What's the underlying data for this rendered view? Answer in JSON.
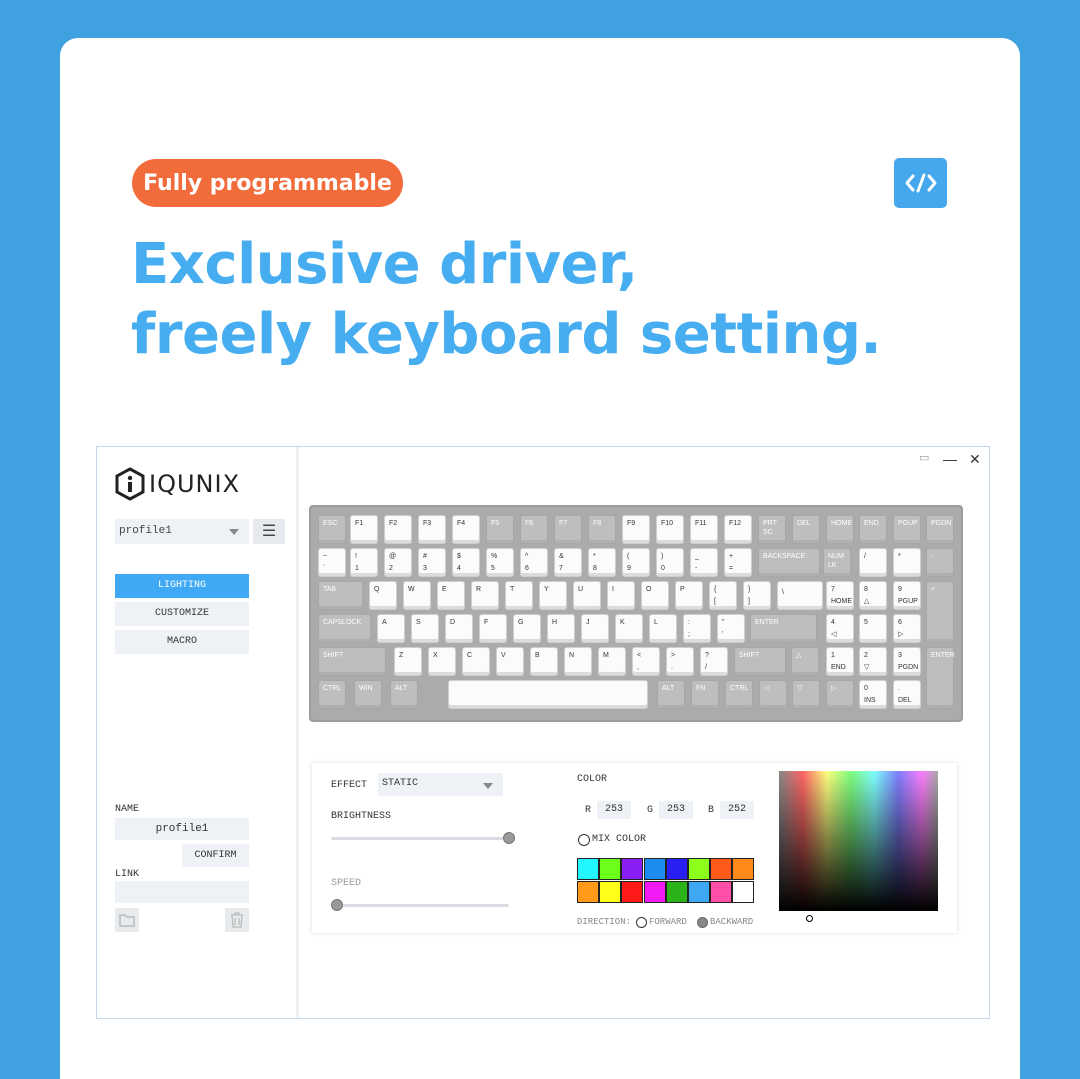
{
  "promo": {
    "badge": "Fully programmable",
    "code_icon": "code-icon",
    "headline_line1": "Exclusive driver,",
    "headline_line2": "freely keyboard setting."
  },
  "app": {
    "brand": "IQUNIX",
    "profile_select": "profile1",
    "menu_icon": "☰",
    "nav": [
      "LIGHTING",
      "CUSTOMIZE",
      "MACRO"
    ],
    "active_nav": "LIGHTING",
    "name_label": "NAME",
    "name_value": "profile1",
    "confirm_label": "CONFIRM",
    "link_label": "LINK",
    "link_value": "",
    "window_controls": [
      "▭",
      "—",
      "✕"
    ]
  },
  "keyboard": {
    "rows": [
      [
        [
          "ESC",
          "g"
        ],
        [
          "F1",
          "w"
        ],
        [
          "F2",
          "w"
        ],
        [
          "F3",
          "w"
        ],
        [
          "F4",
          "w"
        ],
        [
          "F5",
          "g"
        ],
        [
          "F6",
          "g"
        ],
        [
          "F7",
          "g"
        ],
        [
          "F8",
          "g"
        ],
        [
          "F9",
          "w"
        ],
        [
          "F10",
          "w"
        ],
        [
          "F11",
          "w"
        ],
        [
          "F12",
          "w"
        ],
        [
          "PRT SC",
          "g"
        ],
        [
          "DEL",
          "g"
        ],
        [
          "HOME",
          "g"
        ],
        [
          "END",
          "g"
        ],
        [
          "PGUP",
          "g"
        ],
        [
          "PGDN",
          "g"
        ]
      ],
      [
        [
          "~|`",
          "w"
        ],
        [
          "!|1",
          "w"
        ],
        [
          "@|2",
          "w"
        ],
        [
          "#|3",
          "w"
        ],
        [
          "$|4",
          "w"
        ],
        [
          "%|5",
          "w"
        ],
        [
          "^|6",
          "w"
        ],
        [
          "&|7",
          "w"
        ],
        [
          "*|8",
          "w"
        ],
        [
          "(|9",
          "w"
        ],
        [
          ")|0",
          "w"
        ],
        [
          "_|-",
          "w"
        ],
        [
          "+|=",
          "w"
        ],
        [
          "BACKSPACE",
          "g"
        ],
        [
          "NUM LK",
          "g"
        ],
        [
          "/",
          "w"
        ],
        [
          "*",
          "w"
        ],
        [
          "-",
          "g"
        ]
      ],
      [
        [
          "TAB",
          "g"
        ],
        [
          "Q",
          "w"
        ],
        [
          "W",
          "w"
        ],
        [
          "E",
          "w"
        ],
        [
          "R",
          "w"
        ],
        [
          "T",
          "w"
        ],
        [
          "Y",
          "w"
        ],
        [
          "U",
          "w"
        ],
        [
          "I",
          "w"
        ],
        [
          "O",
          "w"
        ],
        [
          "P",
          "w"
        ],
        [
          "{|[",
          "w"
        ],
        [
          "}|]",
          "w"
        ],
        [
          "||\\",
          "w"
        ],
        [
          "7|HOME",
          "w"
        ],
        [
          "8|△",
          "w"
        ],
        [
          "9|PGUP",
          "w"
        ],
        [
          "+",
          "g"
        ]
      ],
      [
        [
          "CAPSLOCK",
          "g"
        ],
        [
          "A",
          "w"
        ],
        [
          "S",
          "w"
        ],
        [
          "D",
          "w"
        ],
        [
          "F",
          "w"
        ],
        [
          "G",
          "w"
        ],
        [
          "H",
          "w"
        ],
        [
          "J",
          "w"
        ],
        [
          "K",
          "w"
        ],
        [
          "L",
          "w"
        ],
        [
          ":|;",
          "w"
        ],
        [
          "\"|'",
          "w"
        ],
        [
          "ENTER",
          "g"
        ],
        [
          "4|◁",
          "w"
        ],
        [
          "5",
          "w"
        ],
        [
          "6|▷",
          "w"
        ]
      ],
      [
        [
          "SHIFT",
          "g"
        ],
        [
          "Z",
          "w"
        ],
        [
          "X",
          "w"
        ],
        [
          "C",
          "w"
        ],
        [
          "V",
          "w"
        ],
        [
          "B",
          "w"
        ],
        [
          "N",
          "w"
        ],
        [
          "M",
          "w"
        ],
        [
          "<|,",
          "w"
        ],
        [
          ">|.",
          "w"
        ],
        [
          "?|/",
          "w"
        ],
        [
          "SHIFT",
          "g"
        ],
        [
          "△",
          "g"
        ],
        [
          "1|END",
          "w"
        ],
        [
          "2|▽",
          "w"
        ],
        [
          "3|PGDN",
          "w"
        ],
        [
          "ENTER",
          "g"
        ]
      ],
      [
        [
          "CTRL",
          "g"
        ],
        [
          "WIN",
          "g"
        ],
        [
          "ALT",
          "g"
        ],
        [
          "",
          "w"
        ],
        [
          "ALT",
          "g"
        ],
        [
          "FN",
          "g"
        ],
        [
          "CTRL",
          "g"
        ],
        [
          "◁",
          "g"
        ],
        [
          "▽",
          "g"
        ],
        [
          "▷",
          "g"
        ],
        [
          "0|INS",
          "w"
        ],
        [
          ".|DEL",
          "w"
        ]
      ]
    ]
  },
  "lighting": {
    "effect_label": "EFFECT",
    "effect_value": "STATIC",
    "brightness_label": "BRIGHTNESS",
    "brightness": 1.0,
    "speed_label": "SPEED",
    "speed": 0.0,
    "color_label": "COLOR",
    "r_label": "R",
    "r": "253",
    "g_label": "G",
    "g": "253",
    "b_label": "B",
    "b": "252",
    "mix_color_label": "MIX COLOR",
    "direction_label": "DIRECTION:",
    "forward_label": "FORWARD",
    "backward_label": "BACKWARD",
    "selected_direction": "BACKWARD",
    "swatches": [
      "#21f7ff",
      "#6cff1a",
      "#8a1ef7",
      "#1c8cf0",
      "#2a1ff2",
      "#8cff1a",
      "#ff5a1a",
      "#ff8a1a",
      "#ff9a1a",
      "#ffff1a",
      "#ff1a1a",
      "#f21af7",
      "#2bb31a",
      "#3ea8f5",
      "#ff4fa8",
      "#ffffff"
    ]
  }
}
